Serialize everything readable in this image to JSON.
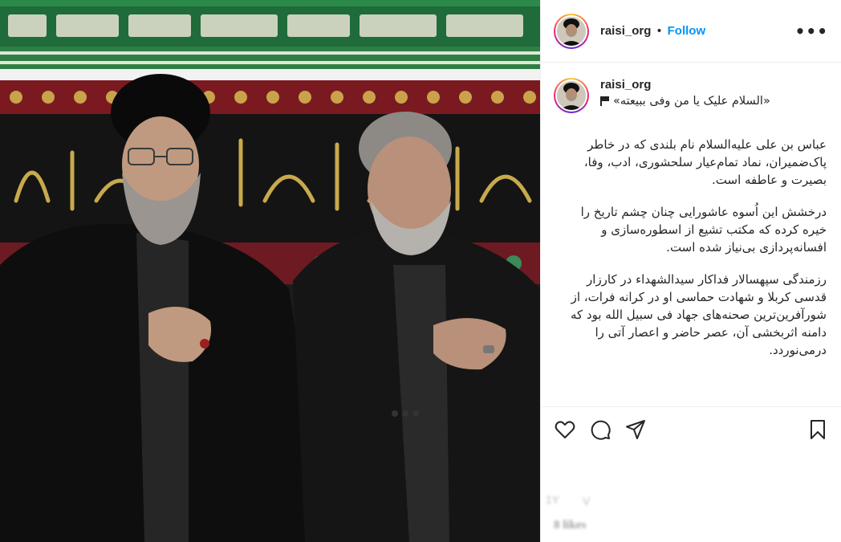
{
  "post": {
    "username": "raisi_org",
    "follow_label": "Follow",
    "more_label": "•••",
    "separator": "•"
  },
  "caption": {
    "first_line": "«السلام علیک یا من وفی ببیعته»",
    "paragraphs": [
      "عباس بن علی علیه‌السلام نام بلندی که در خاطر پاک‌ضمیران، نماد تمام‌عیار سلحشوری، ادب، وفا، بصیرت و عاطفه است.",
      "درخشش این اُسوه عاشورایی چنان چشم تاریخ را خیره کرده که مکتب تشیع از اسطوره‌سازی و افسانه‌پردازی بی‌نیاز شده است.",
      "رزمندگی سپهسالار فداکار سیدالشهداء در کارزار قدسی کربلا و شهادت حماسی او در کرانه فرات، از شورآفرین‌ترین صحنه‌های جهاد فی سبیل الله بود که دامنه اثربخشی آن، عصر حاضر و اعصار آتی را درمی‌نوردد."
    ]
  },
  "below": {
    "likes_text": "8 likes",
    "ghost_a": "1Y",
    "ghost_b": "V"
  },
  "icons": {
    "heart": "heart-icon",
    "comment": "comment-icon",
    "share": "share-icon",
    "save": "bookmark-icon",
    "flag": "flag-icon"
  },
  "colors": {
    "follow": "#0095f6",
    "text": "#262626",
    "divider": "#efefef"
  }
}
